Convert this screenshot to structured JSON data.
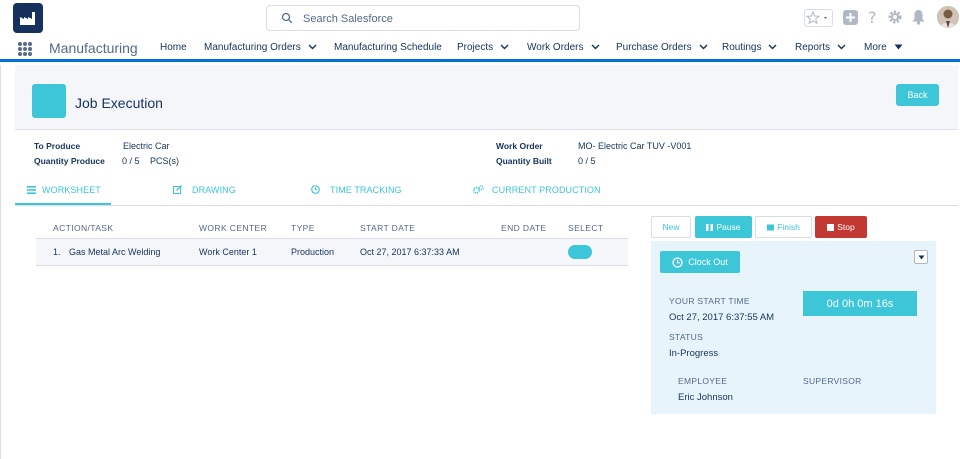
{
  "search": {
    "placeholder": "Search Salesforce"
  },
  "app": {
    "name": "Manufacturing"
  },
  "nav": {
    "items": [
      {
        "label": "Home",
        "chevron": false
      },
      {
        "label": "Manufacturing Orders",
        "chevron": true
      },
      {
        "label": "Manufacturing Schedule",
        "chevron": false
      },
      {
        "label": "Projects",
        "chevron": true
      },
      {
        "label": "Work Orders",
        "chevron": true
      },
      {
        "label": "Purchase Orders",
        "chevron": true
      },
      {
        "label": "Routings",
        "chevron": true
      },
      {
        "label": "Reports",
        "chevron": true
      },
      {
        "label": "More",
        "chevron": true
      }
    ]
  },
  "header": {
    "title": "Job Execution",
    "back_label": "Back"
  },
  "details": {
    "to_produce_label": "To Produce",
    "to_produce_value": "Electric Car",
    "quantity_produce_label": "Quantity Produce",
    "quantity_produce_value": "0 / 5",
    "quantity_produce_unit": "PCS(s)",
    "work_order_label": "Work Order",
    "work_order_value": "MO- Electric Car TUV -V001",
    "quantity_built_label": "Quantity Built",
    "quantity_built_value": "0 / 5"
  },
  "tabs": [
    {
      "label": "WORKSHEET",
      "active": true
    },
    {
      "label": "DRAWING",
      "active": false
    },
    {
      "label": "TIME TRACKING",
      "active": false
    },
    {
      "label": "CURRENT PRODUCTION",
      "active": false
    }
  ],
  "table": {
    "headers": [
      "ACTION/TASK",
      "WORK CENTER",
      "TYPE",
      "START DATE",
      "END DATE",
      "SELECT"
    ],
    "rows": [
      {
        "index": "1.",
        "task": "Gas Metal Arc Welding",
        "work_center": "Work Center 1",
        "type": "Production",
        "start_date": "Oct 27, 2017 6:37:33 AM",
        "end_date": "",
        "selected": true
      }
    ]
  },
  "actions": {
    "new": "New",
    "pause": "Pause",
    "finish": "Finish",
    "stop": "Stop"
  },
  "panel": {
    "clock_out_label": "Clock Out",
    "start_time_label": "YOUR START TIME",
    "start_time_value": "Oct 27, 2017 6:37:55 AM",
    "timer_value": "0d 0h 0m 16s",
    "status_label": "STATUS",
    "status_value": "In-Progress",
    "employee_label": "EMPLOYEE",
    "employee_value": "Eric Johnson",
    "supervisor_label": "SUPERVISOR"
  },
  "colors": {
    "accent": "#3dc6d8",
    "brand": "#0070d2",
    "stop": "#c23934",
    "text": "#16325c"
  }
}
